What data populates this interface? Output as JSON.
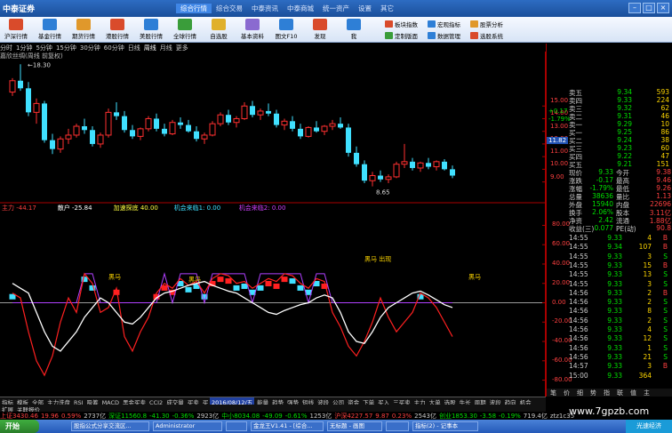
{
  "app": {
    "logo_text": "中泰证券",
    "menu": [
      "综合行情",
      "综合交易",
      "中泰资讯",
      "中泰商城",
      "统一资产",
      "设置",
      "其它"
    ],
    "active_menu": "综合行情"
  },
  "toolbar": {
    "buttons": [
      {
        "label": "沪深行情",
        "icon": "quote-icon",
        "color": "#d94b2b"
      },
      {
        "label": "基金行情",
        "icon": "fund-icon",
        "color": "#2e7fd6"
      },
      {
        "label": "期货行情",
        "icon": "futures-icon",
        "color": "#e0982b"
      },
      {
        "label": "港股行情",
        "icon": "hk-icon",
        "color": "#d94b2b"
      },
      {
        "label": "美股行情",
        "icon": "us-icon",
        "color": "#2e7fd6"
      },
      {
        "label": "全球行情",
        "icon": "global-icon",
        "color": "#3a9d3a"
      },
      {
        "label": "自选股",
        "icon": "star-icon",
        "color": "#e0b02b"
      },
      {
        "label": "基本资料",
        "icon": "document-icon",
        "color": "#8a6ad0"
      },
      {
        "label": "图文F10",
        "icon": "f10-icon",
        "color": "#2e7fd6"
      },
      {
        "label": "发现",
        "icon": "compass-icon",
        "color": "#d94b2b"
      },
      {
        "label": "我",
        "icon": "user-icon",
        "color": "#2e7fd6"
      }
    ],
    "side_buttons": [
      {
        "label": "板块指数",
        "icon": "block-icon",
        "color": "#d94b2b"
      },
      {
        "label": "宏观指标",
        "icon": "macro-icon",
        "color": "#2e7fd6"
      },
      {
        "label": "股票分析",
        "icon": "analysis-icon",
        "color": "#e0982b"
      },
      {
        "label": "定制版面",
        "icon": "layout-icon",
        "color": "#3a9d3a"
      },
      {
        "label": "数据管理",
        "icon": "data-icon",
        "color": "#2e7fd6"
      },
      {
        "label": "选股系统",
        "icon": "select-icon",
        "color": "#d94b2b"
      }
    ]
  },
  "periods": [
    "分时",
    "1分钟",
    "5分钟",
    "15分钟",
    "30分钟",
    "60分钟",
    "日线",
    "周线",
    "月线",
    "更多"
  ],
  "selected_period": "周线",
  "chart_header": "嘉欣丝绸(周线 前复权)",
  "price_chart": {
    "high_label": "18.30",
    "low_label": "8.65",
    "y_ticks": [
      "15.00",
      "14.00",
      "13.00",
      "12.00",
      "11.00",
      "10.00",
      "9.00"
    ],
    "current_price_label": "11.82",
    "candles": [
      [
        16.1,
        17.2,
        15.8,
        17.0
      ],
      [
        17.0,
        18.3,
        16.2,
        16.4
      ],
      [
        16.4,
        16.9,
        14.2,
        14.5
      ],
      [
        14.5,
        15.6,
        13.6,
        15.2
      ],
      [
        15.2,
        15.4,
        12.1,
        12.3
      ],
      [
        12.3,
        12.8,
        11.2,
        11.6
      ],
      [
        11.6,
        12.6,
        11.3,
        12.4
      ],
      [
        12.4,
        13.2,
        12.0,
        12.7
      ],
      [
        12.7,
        13.6,
        12.5,
        13.4
      ],
      [
        13.4,
        14.0,
        12.8,
        13.1
      ],
      [
        13.1,
        13.4,
        11.8,
        12.0
      ],
      [
        12.0,
        12.9,
        11.7,
        12.7
      ],
      [
        12.7,
        14.8,
        12.5,
        14.5
      ],
      [
        14.5,
        15.3,
        13.9,
        14.2
      ],
      [
        14.2,
        14.6,
        12.9,
        13.1
      ],
      [
        13.1,
        13.5,
        12.4,
        12.6
      ],
      [
        12.6,
        13.3,
        12.3,
        13.2
      ],
      [
        13.2,
        14.2,
        13.0,
        14.0
      ],
      [
        14.0,
        14.4,
        13.0,
        13.2
      ],
      [
        13.2,
        13.6,
        12.6,
        12.8
      ],
      [
        12.8,
        13.9,
        12.7,
        13.7
      ],
      [
        13.7,
        14.1,
        13.2,
        13.5
      ],
      [
        13.5,
        13.9,
        12.9,
        13.0
      ],
      [
        13.0,
        13.4,
        12.2,
        12.4
      ],
      [
        12.4,
        12.9,
        12.0,
        12.7
      ],
      [
        12.7,
        13.8,
        12.6,
        13.6
      ],
      [
        13.6,
        14.5,
        13.4,
        14.3
      ],
      [
        14.3,
        14.7,
        13.5,
        13.7
      ],
      [
        13.7,
        14.2,
        13.3,
        14.0
      ],
      [
        14.0,
        15.3,
        13.9,
        15.0
      ],
      [
        15.0,
        15.4,
        14.1,
        14.3
      ],
      [
        14.3,
        14.8,
        13.9,
        14.6
      ],
      [
        14.6,
        15.2,
        14.2,
        14.4
      ],
      [
        14.4,
        14.7,
        13.3,
        13.5
      ],
      [
        13.5,
        14.0,
        13.1,
        13.8
      ],
      [
        13.8,
        14.2,
        13.0,
        13.2
      ],
      [
        13.2,
        13.6,
        12.4,
        12.6
      ],
      [
        12.6,
        13.4,
        12.5,
        13.3
      ],
      [
        13.3,
        13.8,
        12.9,
        13.0
      ],
      [
        13.0,
        13.5,
        12.7,
        13.4
      ],
      [
        13.4,
        13.9,
        13.1,
        13.6
      ],
      [
        13.6,
        14.1,
        13.2,
        13.3
      ],
      [
        13.3,
        13.6,
        11.0,
        11.3
      ],
      [
        11.3,
        11.8,
        10.2,
        10.4
      ],
      [
        10.4,
        10.7,
        8.9,
        9.1
      ],
      [
        9.1,
        9.8,
        8.65,
        9.5
      ],
      [
        9.5,
        9.9,
        9.0,
        9.2
      ],
      [
        9.2,
        9.6,
        8.9,
        9.4
      ],
      [
        9.4,
        10.6,
        9.3,
        10.4
      ],
      [
        10.4,
        12.0,
        10.1,
        10.6
      ],
      [
        10.6,
        10.9,
        9.9,
        10.1
      ],
      [
        10.1,
        10.6,
        9.8,
        10.5
      ],
      [
        10.5,
        10.9,
        10.0,
        10.2
      ],
      [
        10.2,
        10.7,
        9.9,
        10.6
      ],
      [
        10.6,
        10.8,
        9.9,
        10.0
      ],
      [
        10.0,
        10.3,
        9.3,
        9.5
      ]
    ]
  },
  "indicator": {
    "header": [
      {
        "text": "主力 -44.17",
        "color": "#ff4040"
      },
      {
        "text": "散户 -25.84",
        "color": "#ffffff"
      },
      {
        "text": "加速探底 40.00",
        "color": "#ffff40"
      },
      {
        "text": "机会来临1: 0.00",
        "color": "#40e0ff"
      },
      {
        "text": "机会来临2: 0.00",
        "color": "#d040ff"
      }
    ],
    "y_ticks": [
      "80.00",
      "60.00",
      "40.00",
      "20.00",
      "0.00",
      "-20.00",
      "-40.00",
      "-60.00",
      "-80.00"
    ],
    "labels": [
      {
        "text": "黑马",
        "color": "#ffd700"
      },
      {
        "text": "黑马",
        "color": "#ffd700"
      },
      {
        "text": "黑马 出现",
        "color": "#ffd700"
      },
      {
        "text": "黑马",
        "color": "#ffd700"
      }
    ],
    "main_force": [
      10,
      5,
      -30,
      -60,
      -75,
      -55,
      -20,
      5,
      -10,
      30,
      20,
      -10,
      -5,
      15,
      -35,
      -50,
      -30,
      -15,
      10,
      20,
      15,
      25,
      18,
      22,
      10,
      25,
      30,
      28,
      20,
      22,
      15,
      20,
      25,
      22,
      30,
      28,
      20,
      15,
      25,
      22,
      -10,
      -25,
      -45,
      -55,
      -40,
      -20,
      5,
      -15,
      -30,
      -20,
      -10,
      10,
      5,
      -5,
      -20,
      -35
    ],
    "retail": [
      20,
      15,
      10,
      -10,
      -30,
      -45,
      -50,
      -40,
      -30,
      -15,
      -5,
      5,
      0,
      -10,
      -20,
      -22,
      -15,
      -5,
      5,
      10,
      12,
      15,
      18,
      20,
      22,
      18,
      15,
      12,
      10,
      5,
      0,
      -5,
      -10,
      -12,
      -8,
      -5,
      -2,
      0,
      5,
      8,
      5,
      -10,
      -30,
      -40,
      -42,
      -30,
      -15,
      -5,
      0,
      5,
      10,
      12,
      8,
      3,
      -2,
      -5
    ]
  },
  "right_panel": {
    "quotes": [
      {
        "label": "卖五",
        "price": "9.34",
        "vol": "593",
        "pc": "#00e000"
      },
      {
        "label": "卖四",
        "price": "9.33",
        "vol": "224",
        "pc": "#00e000"
      },
      {
        "label": "卖三",
        "price": "9.32",
        "vol": "62",
        "pc": "#00e000"
      },
      {
        "label": "卖二",
        "price": "9.31",
        "vol": "46",
        "pc": "#00e000"
      },
      {
        "label": "卖一",
        "price": "9.29",
        "vol": "10",
        "pc": "#00e000"
      },
      {
        "label": "买一",
        "price": "9.25",
        "vol": "86",
        "pc": "#00e000"
      },
      {
        "label": "买二",
        "price": "9.24",
        "vol": "38",
        "pc": "#00e000"
      },
      {
        "label": "买三",
        "price": "9.23",
        "vol": "60",
        "pc": "#00e000"
      },
      {
        "label": "买四",
        "price": "9.22",
        "vol": "47",
        "pc": "#00e000"
      },
      {
        "label": "买五",
        "price": "9.21",
        "vol": "151",
        "pc": "#00e000"
      }
    ],
    "stats": [
      {
        "l1": "现价",
        "v1": "9.33",
        "l2": "今开",
        "v2": "9.38"
      },
      {
        "l1": "涨跌",
        "v1": "-0.17",
        "l2": "最高",
        "v2": "9.46"
      },
      {
        "l1": "涨幅",
        "v1": "-1.79%",
        "l2": "最低",
        "v2": "9.26"
      },
      {
        "l1": "总量",
        "v1": "38636",
        "l2": "量比",
        "v2": "1.13"
      },
      {
        "l1": "外盘",
        "v1": "15940",
        "l2": "内盘",
        "v2": "22696"
      },
      {
        "l1": "换手",
        "v1": "2.06%",
        "l2": "股本",
        "v2": "3.11亿"
      },
      {
        "l1": "净资",
        "v1": "2.42",
        "l2": "流通",
        "v2": "1.88亿"
      },
      {
        "l1": "收益(三)",
        "v1": "0.077",
        "l2": "PE(动)",
        "v2": "90.8"
      }
    ],
    "side_ticks": [
      "+0.17",
      "-1.79%"
    ],
    "trades": [
      {
        "time": "14:55",
        "price": "9.33",
        "vol": "4",
        "side": "B"
      },
      {
        "time": "14:55",
        "price": "9.34",
        "vol": "107",
        "side": "B"
      },
      {
        "time": "14:55",
        "price": "9.33",
        "vol": "3",
        "side": "S"
      },
      {
        "time": "14:55",
        "price": "9.33",
        "vol": "15",
        "side": "B"
      },
      {
        "time": "14:55",
        "price": "9.33",
        "vol": "13",
        "side": "S"
      },
      {
        "time": "14:55",
        "price": "9.33",
        "vol": "3",
        "side": "S"
      },
      {
        "time": "14:56",
        "price": "9.33",
        "vol": "2",
        "side": "B"
      },
      {
        "time": "14:56",
        "price": "9.33",
        "vol": "2",
        "side": "S"
      },
      {
        "time": "14:56",
        "price": "9.33",
        "vol": "8",
        "side": "S"
      },
      {
        "time": "14:56",
        "price": "9.33",
        "vol": "2",
        "side": "S"
      },
      {
        "time": "14:56",
        "price": "9.33",
        "vol": "4",
        "side": "S"
      },
      {
        "time": "14:56",
        "price": "9.33",
        "vol": "12",
        "side": "S"
      },
      {
        "time": "14:56",
        "price": "9.33",
        "vol": "1",
        "side": "S"
      },
      {
        "time": "14:56",
        "price": "9.33",
        "vol": "21",
        "side": "S"
      },
      {
        "time": "14:57",
        "price": "9.33",
        "vol": "3",
        "side": "B"
      },
      {
        "time": "15:00",
        "price": "9.33",
        "vol": "364",
        "side": ""
      }
    ],
    "bottom_tabs": [
      "笔",
      "价",
      "细",
      "势",
      "指",
      "联",
      "值",
      "主"
    ]
  },
  "bottom_tabs": [
    "指标",
    "模板",
    "全部",
    "主力洗盘",
    "RSI",
    "吸筹",
    "MACD",
    "黑金买卖",
    "CCI2",
    "成交量",
    "买卖",
    "买",
    "卖",
    "MACD",
    "加速",
    "能量",
    "趋势",
    "强势",
    "短线",
    "波段",
    "公司",
    "资金",
    "下单",
    "买入",
    "三买卖",
    "主力",
    "大单",
    "选股",
    "牛长",
    "周期",
    "波段",
    "趋向",
    "机会",
    "获利",
    "6金叉",
    "防线",
    "周线"
  ],
  "bottom_date": "2016/08/12/五",
  "bottom_tabs2": [
    "扩展",
    "关联报价"
  ],
  "ticker": [
    {
      "text": "上证3430.46",
      "color": "#ff4040"
    },
    {
      "text": "19.96",
      "color": "#ff4040"
    },
    {
      "text": "0.59%",
      "color": "#ff4040"
    },
    {
      "text": "2737亿",
      "color": "#cccccc"
    },
    {
      "text": "深证11560.8",
      "color": "#00e000"
    },
    {
      "text": "-41.30",
      "color": "#00e000"
    },
    {
      "text": "-0.36%",
      "color": "#00e000"
    },
    {
      "text": "2923亿",
      "color": "#cccccc"
    },
    {
      "text": "中小8034.08",
      "color": "#00e000"
    },
    {
      "text": "-49.09",
      "color": "#00e000"
    },
    {
      "text": "-0.61%",
      "color": "#00e000"
    },
    {
      "text": "1253亿",
      "color": "#cccccc"
    },
    {
      "text": "沪深4227.57",
      "color": "#ff4040"
    },
    {
      "text": "9.87",
      "color": "#ff4040"
    },
    {
      "text": "0.23%",
      "color": "#ff4040"
    },
    {
      "text": "2543亿",
      "color": "#cccccc"
    },
    {
      "text": "创业1853.30",
      "color": "#00e000"
    },
    {
      "text": "-3.58",
      "color": "#00e000"
    },
    {
      "text": "-0.19%",
      "color": "#00e000"
    },
    {
      "text": "719.4亿",
      "color": "#cccccc"
    },
    {
      "text": "ztz1c35",
      "color": "#cccccc"
    }
  ],
  "taskbar": {
    "start": "开始",
    "tasks": [
      "股指公式分享交流区...",
      "Administrator",
      "",
      "金龙王V1.41 - [综合...",
      "无标题 - 画图",
      "",
      "指标(2) - 记事本"
    ],
    "tray": "光速经济"
  },
  "watermark": "www.7gpzb.com"
}
